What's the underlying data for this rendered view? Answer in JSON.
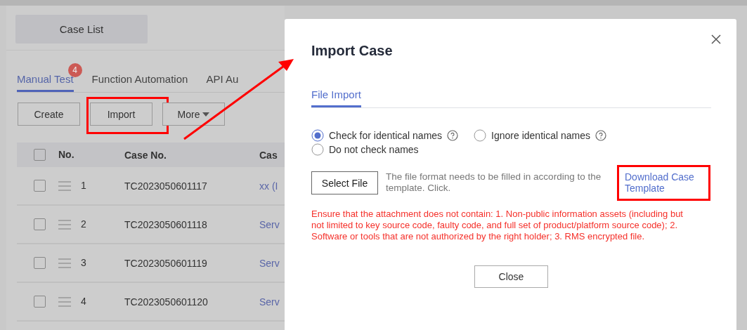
{
  "page": {
    "title_tab": "Case List",
    "tabs": [
      {
        "label": "Manual Test",
        "selected": true,
        "badge": "4"
      },
      {
        "label": "Function Automation",
        "selected": false
      },
      {
        "label": "API Au",
        "selected": false
      }
    ],
    "buttons": [
      {
        "label": "Create",
        "kind": "plain",
        "highlighted": false
      },
      {
        "label": "Import",
        "kind": "plain",
        "highlighted": true
      },
      {
        "label": "More",
        "kind": "dropdown",
        "highlighted": false
      }
    ],
    "table": {
      "columns": [
        "No.",
        "Case No.",
        "Cas"
      ],
      "header_checked": false,
      "rows": [
        {
          "checked": false,
          "no": "1",
          "case_no": "TC2023050601117",
          "name": "xx (I"
        },
        {
          "checked": false,
          "no": "2",
          "case_no": "TC2023050601118",
          "name": "Serv"
        },
        {
          "checked": false,
          "no": "3",
          "case_no": "TC2023050601119",
          "name": "Serv"
        },
        {
          "checked": false,
          "no": "4",
          "case_no": "TC2023050601120",
          "name": "Serv"
        }
      ]
    }
  },
  "dialog": {
    "title": "Import Case",
    "tabs": [
      {
        "label": "File Import",
        "selected": true
      }
    ],
    "options": [
      {
        "label": "Check for identical names",
        "selected": true,
        "help": true
      },
      {
        "label": "Ignore identical names",
        "selected": false,
        "help": true
      },
      {
        "label": "Do not check names",
        "selected": false,
        "help": false
      }
    ],
    "select_button": "Select File",
    "hint": "The file format needs to be filled in according to the template. Click.",
    "link": "Download Case Template",
    "link_highlighted": true,
    "warning": "Ensure that the attachment does not contain: 1. Non-public information assets (including but not limited to key source code, faulty code, and full set of product/platform source code); 2. Software or tools that are not authorized by the right holder; 3. RMS encrypted file.",
    "close_button": "Close"
  }
}
